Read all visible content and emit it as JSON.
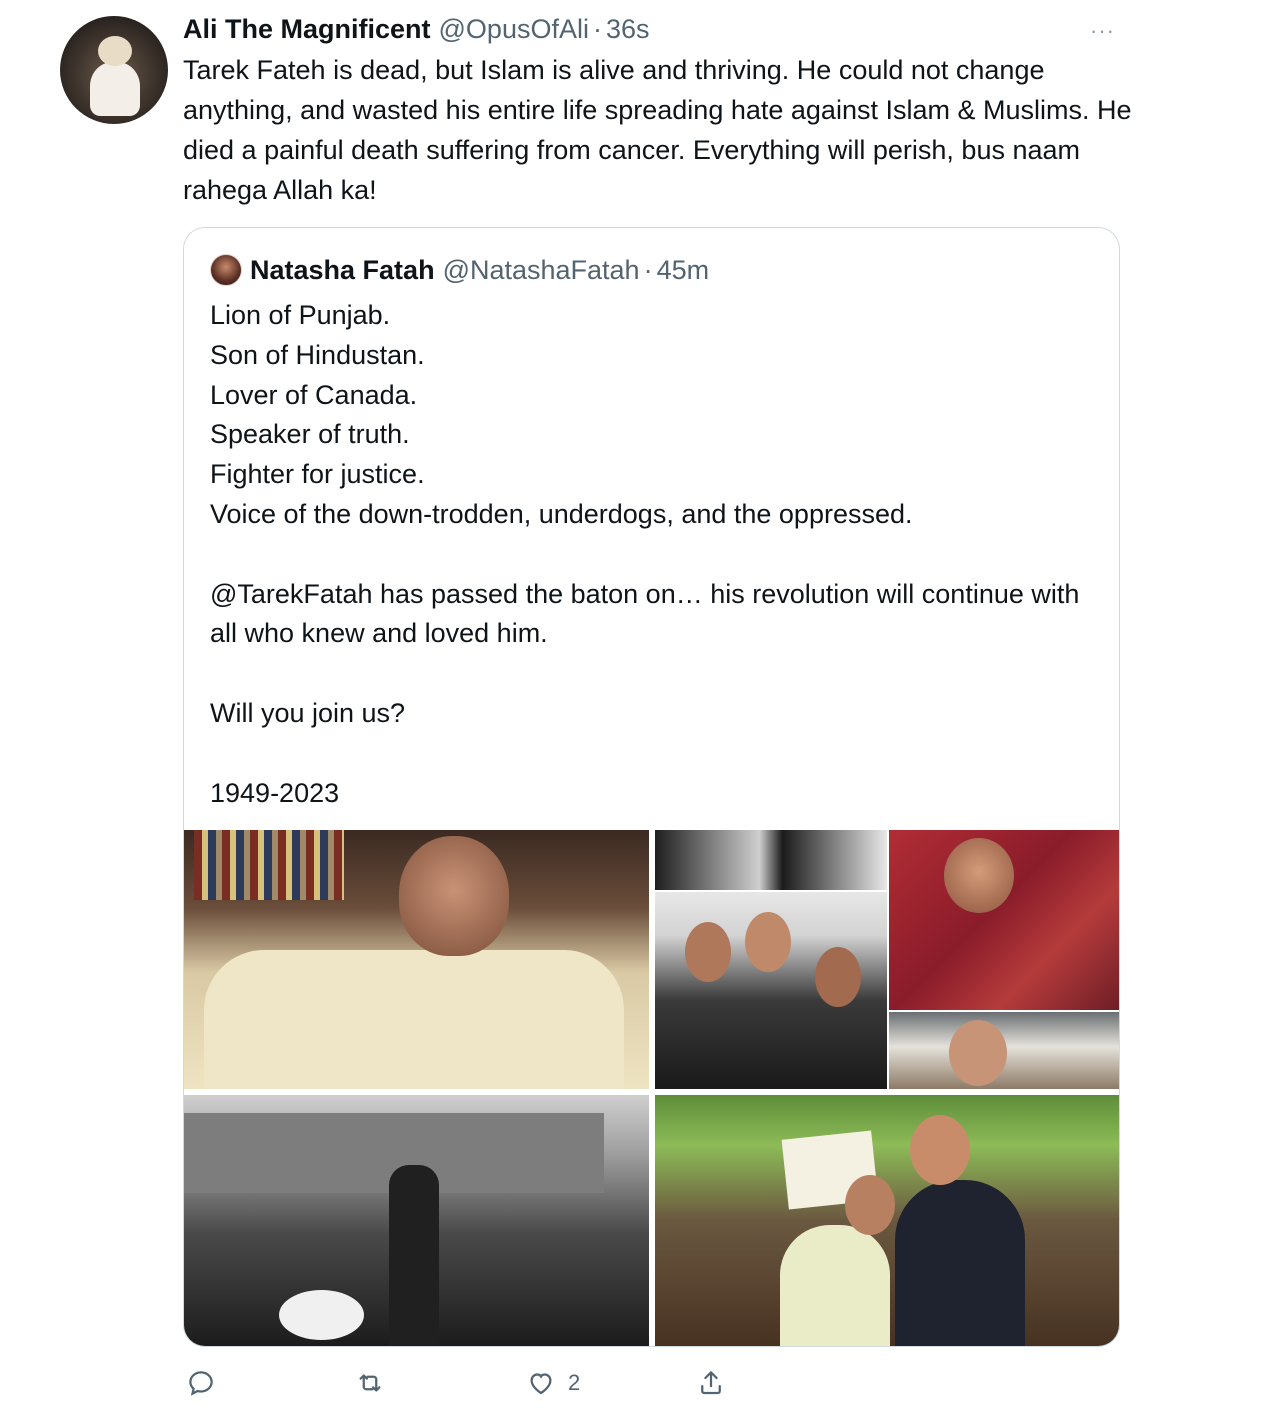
{
  "tweet": {
    "author_name": "Ali The Magnificent",
    "author_handle": "@OpusOfAli",
    "separator": "·",
    "time": "36s",
    "more_label": "···",
    "text": "Tarek Fateh is dead, but Islam is alive and thriving. He could not change anything, and wasted his entire life spreading hate against Islam & Muslims. He died a painful death suffering from cancer. Everything will perish, bus naam rahega Allah ka!"
  },
  "quoted": {
    "author_name": "Natasha Fatah",
    "author_handle": "@NatashaFatah",
    "separator": "·",
    "time": "45m",
    "lines": [
      "Lion of Punjab.",
      "Son of Hindustan.",
      "Lover of Canada.",
      "Speaker of truth.",
      "Fighter for justice.",
      "Voice of the down-trodden, underdogs, and the oppressed."
    ],
    "paragraph2": "@TarekFatah has passed the baton on… his revolution will continue with all who knew and loved him.",
    "paragraph3": "Will you join us?",
    "paragraph4": "1949-2023"
  },
  "actions": {
    "reply_icon": "reply-icon",
    "retweet_icon": "retweet-icon",
    "like_icon": "heart-icon",
    "like_count": "2",
    "share_icon": "share-icon"
  },
  "colors": {
    "text_primary": "#0f1419",
    "text_secondary": "#536471",
    "border": "#cfd9de"
  }
}
